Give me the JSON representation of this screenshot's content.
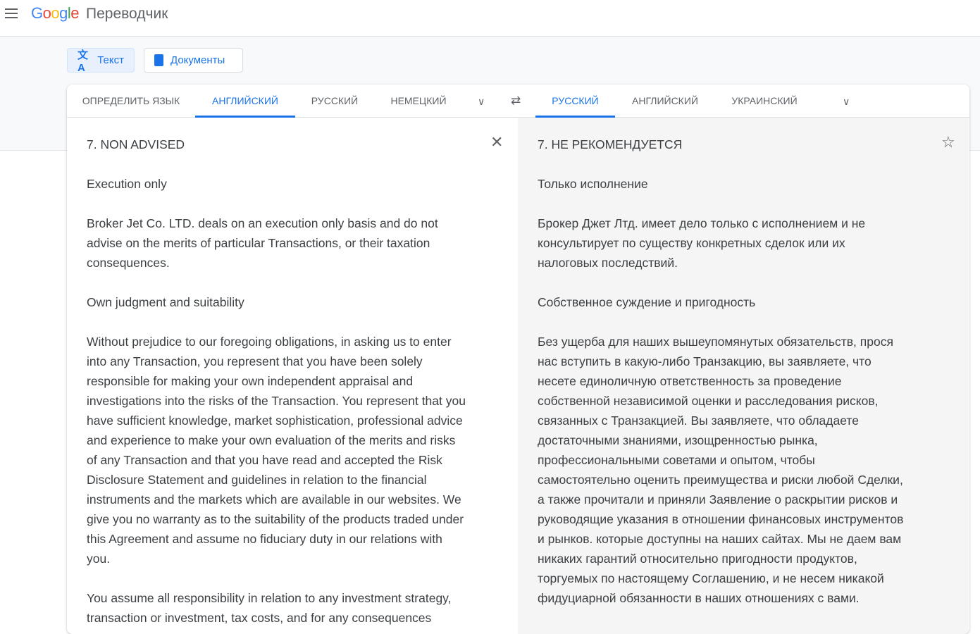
{
  "header": {
    "logo": "Google",
    "product": "Переводчик"
  },
  "modes": [
    {
      "label": "Текст"
    },
    {
      "label": "Документы"
    }
  ],
  "source_tabs": [
    "ОПРЕДЕЛИТЬ ЯЗЫК",
    "АНГЛИЙСКИЙ",
    "РУССКИЙ",
    "НЕМЕЦКИЙ"
  ],
  "target_tabs": [
    "РУССКИЙ",
    "АНГЛИЙСКИЙ",
    "УКРАИНСКИЙ"
  ],
  "active_source": 1,
  "active_target": 0,
  "source_lines": [
    "7. NON ADVISED",
    "",
    "Execution only",
    "",
    "Broker Jet Co. LTD. deals on an execution only basis and do not",
    "advise on the merits of particular Transactions, or their taxation",
    "consequences.",
    "",
    "Own judgment and suitability",
    "",
    "Without prejudice to our foregoing obligations, in asking us to enter",
    "into any Transaction, you represent that you have been solely",
    "responsible for making your own independent appraisal and",
    "investigations into the risks of the Transaction. You represent that you",
    "have sufficient knowledge, market sophistication, professional advice",
    "and experience to make your own evaluation of the merits and risks",
    "of any Transaction and that you have read and accepted the Risk",
    "Disclosure Statement and guidelines in relation to the financial",
    "instruments and the markets which are available in our websites. We",
    "give you no warranty as to the suitability of the products traded under",
    "this Agreement and assume no fiduciary duty in our relations with",
    "you.",
    "",
    "You assume all responsibility in relation to any investment strategy,",
    "transaction or investment, tax costs, and for any consequences"
  ],
  "target_lines": [
    "7. НЕ РЕКОМЕНДУЕТСЯ",
    "",
    "Только исполнение",
    "",
    "Брокер Джет Лтд. имеет дело только с исполнением и не",
    "консультирует по существу конкретных сделок или их",
    "налоговых последствий.",
    "",
    "Собственное суждение и пригодность",
    "",
    "Без ущерба для наших вышеупомянутых обязательств, прося",
    "нас вступить в какую-либо Транзакцию, вы заявляете, что",
    "несете единоличную ответственность за проведение",
    "собственной независимой оценки и расследования рисков,",
    "связанных с Транзакцией. Вы заявляете, что обладаете",
    "достаточными знаниями, изощренностью рынка,",
    "профессиональными советами и опытом, чтобы",
    "самостоятельно оценить преимущества и риски любой Сделки,",
    "а также прочитали и приняли Заявление о раскрытии рисков и",
    "руководящие указания в отношении финансовых инструментов",
    "и рынков. которые доступны на наших сайтах. Мы не даем вам",
    "никаких гарантий относительно пригодности продуктов,",
    "торгуемых по настоящему Соглашению, и не несем никакой",
    "фидуциарной обязанности в наших отношениях с вами."
  ]
}
